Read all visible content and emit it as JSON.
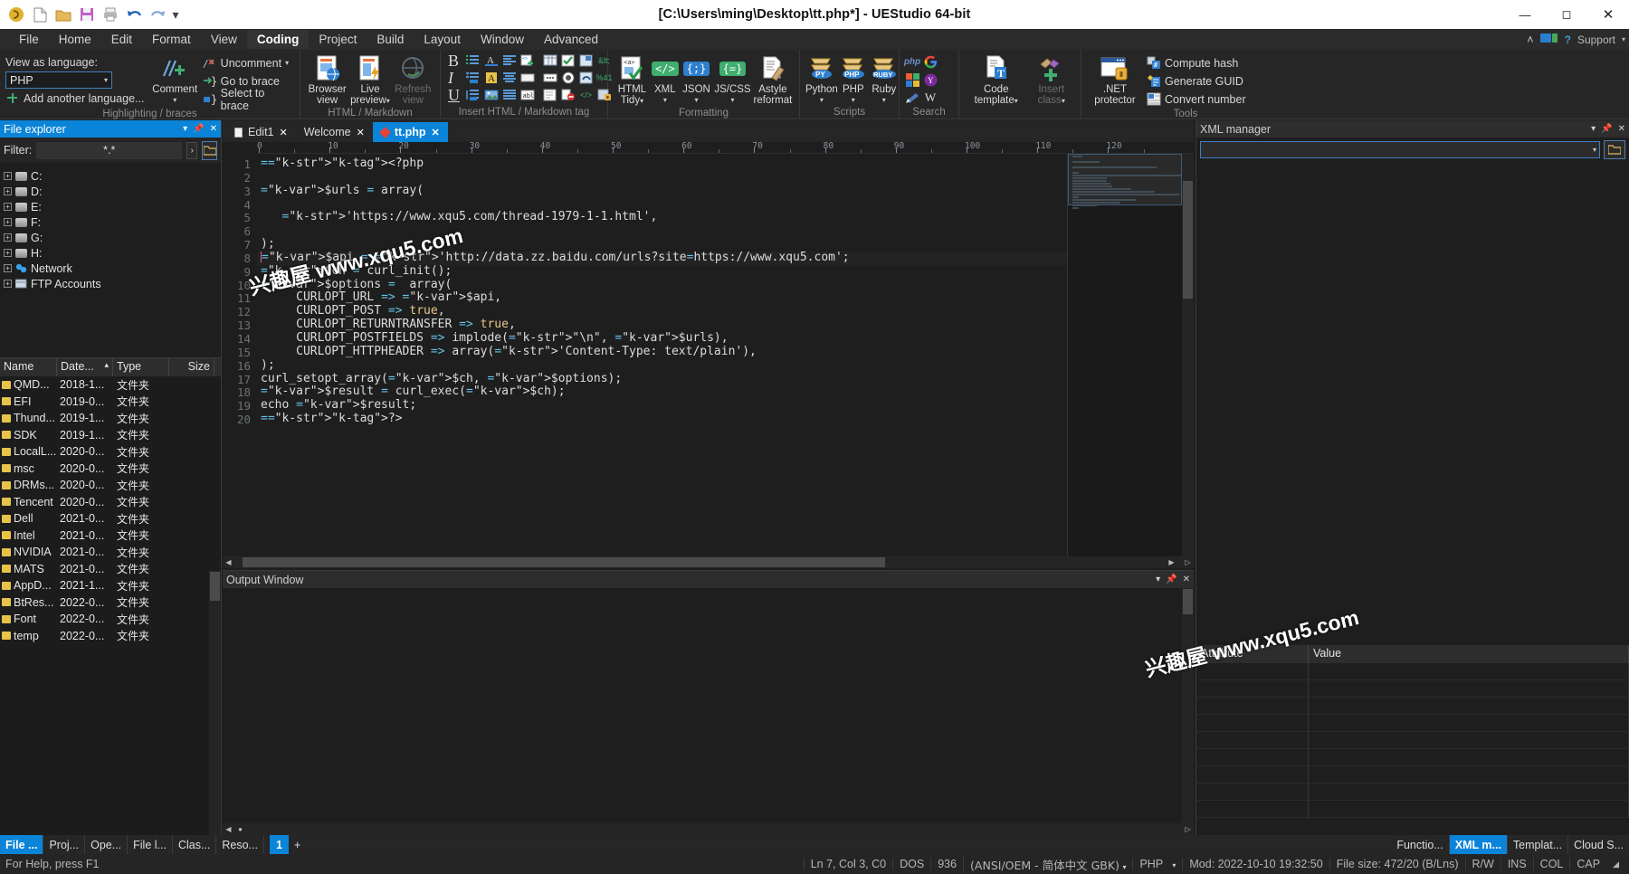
{
  "window": {
    "title": "[C:\\Users\\ming\\Desktop\\tt.php*] - UEStudio 64-bit",
    "minimize": "–",
    "maximize": "☐",
    "close": "✕"
  },
  "quick_access": [
    {
      "name": "app-logo-icon",
      "glyph": "ⓢ"
    },
    {
      "name": "new-file-icon",
      "glyph": "὜B"
    },
    {
      "name": "open-folder-icon",
      "glyph": "Ὄ1"
    },
    {
      "name": "save-icon",
      "glyph": "ὋE"
    },
    {
      "name": "print-icon",
      "glyph": "὚8"
    },
    {
      "name": "undo-icon",
      "glyph": "↶"
    },
    {
      "name": "redo-icon",
      "glyph": "↷"
    },
    {
      "name": "customize-qat-icon",
      "glyph": "▾"
    }
  ],
  "menu": {
    "items": [
      "File",
      "Home",
      "Edit",
      "Format",
      "View",
      "Coding",
      "Project",
      "Build",
      "Layout",
      "Window",
      "Advanced"
    ],
    "active": "Coding",
    "right": {
      "collapse": "˄",
      "account": "▤",
      "help": "?",
      "support": "Support",
      "support_caret": "▾"
    }
  },
  "ribbon": {
    "groups": [
      {
        "label": "Highlighting / braces",
        "view_as_language_label": "View as language:",
        "language_value": "PHP",
        "add_another_language": "Add another language...",
        "comment_label": "Comment",
        "uncomment_label": "Uncomment",
        "go_to_brace": "Go to brace",
        "select_to_brace": "Select to brace"
      },
      {
        "label": "HTML / Markdown",
        "buttons": [
          {
            "name": "browser-view-button",
            "line1": "Browser",
            "line2": "view",
            "disabled": false
          },
          {
            "name": "live-preview-button",
            "line1": "Live",
            "line2": "preview",
            "disabled": false,
            "caret": true
          },
          {
            "name": "refresh-view-button",
            "line1": "Refresh",
            "line2": "view",
            "disabled": true
          }
        ]
      },
      {
        "label": "Insert HTML / Markdown tag",
        "bold": "B",
        "italic": "I",
        "underline": "U"
      },
      {
        "label": "Formatting",
        "buttons": [
          {
            "name": "html-tidy-button",
            "line1": "HTML",
            "line2": "Tidy",
            "caret": true
          },
          {
            "name": "xml-format-button",
            "line1": "XML",
            "line2": "",
            "caret": true,
            "badge": "</>",
            "badgecolor": "#3fae6e"
          },
          {
            "name": "json-format-button",
            "line1": "JSON",
            "line2": "",
            "caret": true,
            "badge": "{;}",
            "badgecolor": "#2f7fd0"
          },
          {
            "name": "jscss-format-button",
            "line1": "JS/CSS",
            "line2": "",
            "caret": true,
            "badge": "{=}",
            "badgecolor": "#3fae6e"
          },
          {
            "name": "astyle-reformat-button",
            "line1": "Astyle",
            "line2": "reformat"
          }
        ]
      },
      {
        "label": "Scripts",
        "buttons": [
          {
            "name": "python-script-button",
            "line1": "Python",
            "badge": "PY",
            "caret": true
          },
          {
            "name": "php-script-button",
            "line1": "PHP",
            "badge": "PHP",
            "caret": true
          },
          {
            "name": "ruby-script-button",
            "line1": "Ruby",
            "badge": "RUBY",
            "caret": true
          }
        ]
      },
      {
        "label": "Search",
        "icons": [
          "php-search-icon",
          "google-search-icon",
          "microsoft-search-icon",
          "yahoo-search-icon",
          "stackoverflow-search-icon",
          "wikipedia-search-icon"
        ]
      },
      {
        "label": "",
        "code_template": {
          "line1": "Code",
          "line2": "template",
          "caret": true
        },
        "insert_class": {
          "line1": "Insert",
          "line2": "class",
          "caret": true,
          "disabled": true
        }
      },
      {
        "label": "Tools",
        "net_protector": {
          "line1": ".NET",
          "line2": "protector"
        },
        "tools": [
          "Compute hash",
          "Generate GUID",
          "Convert number"
        ]
      }
    ]
  },
  "file_explorer": {
    "title": "File explorer",
    "header_icons": [
      "chevron-down-icon",
      "pin-icon",
      "close-icon"
    ],
    "filter_label": "Filter:",
    "filter_value": "*.*",
    "filter_go": "›",
    "browse_icon": "folder-icon",
    "tree": [
      {
        "label": "C:",
        "icon": "drive-icon"
      },
      {
        "label": "D:",
        "icon": "drive-icon"
      },
      {
        "label": "E:",
        "icon": "drive-icon"
      },
      {
        "label": "F:",
        "icon": "drive-icon"
      },
      {
        "label": "G:",
        "icon": "drive-icon"
      },
      {
        "label": "H:",
        "icon": "drive-icon"
      },
      {
        "label": "Network",
        "icon": "network-icon"
      },
      {
        "label": "FTP Accounts",
        "icon": "ftp-icon"
      }
    ],
    "grid": {
      "columns": [
        "Name",
        "Date...",
        "Type",
        "Size"
      ],
      "sort_indicator": "▴",
      "rows": [
        {
          "name": "QMD...",
          "date": "2018-1...",
          "type": "文件夹",
          "size": ""
        },
        {
          "name": "EFI",
          "date": "2019-0...",
          "type": "文件夹",
          "size": ""
        },
        {
          "name": "Thund...",
          "date": "2019-1...",
          "type": "文件夹",
          "size": ""
        },
        {
          "name": "SDK",
          "date": "2019-1...",
          "type": "文件夹",
          "size": ""
        },
        {
          "name": "LocalL...",
          "date": "2020-0...",
          "type": "文件夹",
          "size": ""
        },
        {
          "name": "msc",
          "date": "2020-0...",
          "type": "文件夹",
          "size": ""
        },
        {
          "name": "DRMs...",
          "date": "2020-0...",
          "type": "文件夹",
          "size": ""
        },
        {
          "name": "Tencent",
          "date": "2020-0...",
          "type": "文件夹",
          "size": ""
        },
        {
          "name": "Dell",
          "date": "2021-0...",
          "type": "文件夹",
          "size": ""
        },
        {
          "name": "Intel",
          "date": "2021-0...",
          "type": "文件夹",
          "size": ""
        },
        {
          "name": "NVIDIA",
          "date": "2021-0...",
          "type": "文件夹",
          "size": ""
        },
        {
          "name": "MATS",
          "date": "2021-0...",
          "type": "文件夹",
          "size": ""
        },
        {
          "name": "AppD...",
          "date": "2021-1...",
          "type": "文件夹",
          "size": ""
        },
        {
          "name": "BtRes...",
          "date": "2022-0...",
          "type": "文件夹",
          "size": ""
        },
        {
          "name": "Font",
          "date": "2022-0...",
          "type": "文件夹",
          "size": ""
        },
        {
          "name": "temp",
          "date": "2022-0...",
          "type": "文件夹",
          "size": ""
        }
      ]
    }
  },
  "editor": {
    "tabs": [
      {
        "label": "Edit1",
        "active": false,
        "icon": "page-icon"
      },
      {
        "label": "Welcome",
        "active": false,
        "icon": "none"
      },
      {
        "label": "tt.php",
        "active": true,
        "icon": "modified-diamond-icon"
      }
    ],
    "ruler_labels": [
      "0",
      "10",
      "20",
      "30",
      "40",
      "50",
      "60",
      "70",
      "80",
      "90",
      "100",
      "110",
      "120"
    ],
    "cursor_line": 8,
    "lines": [
      {
        "n": 1,
        "text": "<?php"
      },
      {
        "n": 2,
        "text": ""
      },
      {
        "n": 3,
        "text": "$urls = array("
      },
      {
        "n": 4,
        "text": ""
      },
      {
        "n": 5,
        "text": "   'https://www.xqu5.com/thread-1979-1-1.html',"
      },
      {
        "n": 6,
        "text": ""
      },
      {
        "n": 7,
        "text": ");"
      },
      {
        "n": 8,
        "text": "$api = 'http://data.zz.baidu.com/urls?site=https://www.xqu5.com';"
      },
      {
        "n": 9,
        "text": "$ch = curl_init();"
      },
      {
        "n": 10,
        "text": "$options =  array("
      },
      {
        "n": 11,
        "text": "     CURLOPT_URL => $api,"
      },
      {
        "n": 12,
        "text": "     CURLOPT_POST => true,"
      },
      {
        "n": 13,
        "text": "     CURLOPT_RETURNTRANSFER => true,"
      },
      {
        "n": 14,
        "text": "     CURLOPT_POSTFIELDS => implode(\"\\n\", $urls),"
      },
      {
        "n": 15,
        "text": "     CURLOPT_HTTPHEADER => array('Content-Type: text/plain'),"
      },
      {
        "n": 16,
        "text": ");"
      },
      {
        "n": 17,
        "text": "curl_setopt_array($ch, $options);"
      },
      {
        "n": 18,
        "text": "$result = curl_exec($ch);"
      },
      {
        "n": 19,
        "text": "echo $result;"
      },
      {
        "n": 20,
        "text": "?>"
      }
    ]
  },
  "output_window": {
    "title": "Output Window",
    "header_icons": [
      "chevron-down-icon",
      "pin-icon",
      "close-icon"
    ],
    "content": ""
  },
  "xml_manager": {
    "title": "XML manager",
    "header_icons": [
      "chevron-down-icon",
      "pin-icon",
      "close-icon"
    ],
    "combo_value": "",
    "combo_caret": "▾",
    "open_icon": "folder-icon",
    "attr_table": {
      "columns": [
        "Attribute",
        "Value"
      ],
      "rows": [
        {
          "attribute": "",
          "value": ""
        },
        {
          "attribute": "",
          "value": ""
        },
        {
          "attribute": "",
          "value": ""
        },
        {
          "attribute": "",
          "value": ""
        },
        {
          "attribute": "",
          "value": ""
        },
        {
          "attribute": "",
          "value": ""
        },
        {
          "attribute": "",
          "value": ""
        },
        {
          "attribute": "",
          "value": ""
        },
        {
          "attribute": "",
          "value": ""
        }
      ]
    }
  },
  "bottom_tabs": {
    "left": [
      {
        "label": "File ...",
        "active": true
      },
      {
        "label": "Proj...",
        "active": false
      },
      {
        "label": "Ope...",
        "active": false
      },
      {
        "label": "File l...",
        "active": false
      },
      {
        "label": "Clas...",
        "active": false
      },
      {
        "label": "Reso...",
        "active": false
      }
    ],
    "group_tab": "1",
    "add_tab": "+",
    "right": [
      {
        "label": "Functio...",
        "active": false
      },
      {
        "label": "XML m...",
        "active": true
      },
      {
        "label": "Templat...",
        "active": false
      },
      {
        "label": "Cloud S...",
        "active": false
      }
    ]
  },
  "statusbar": {
    "help": "For Help, press F1",
    "position": "Ln 7, Col 3, C0",
    "line_ending": "DOS",
    "codepage": "936",
    "encoding": "(ANSI/OEM - 简体中文 GBK)",
    "encoding_caret": "▾",
    "language": "PHP",
    "language_caret": "▾",
    "modified": "Mod: 2022-10-10 19:32:50",
    "filesize": "File size: 472/20 (B/Lns)",
    "rw": "R/W",
    "ins": "INS",
    "col": "COL",
    "cap": "CAP"
  },
  "watermarks": [
    {
      "cn": "兴趣屋",
      "url": "www.xqu5.com"
    },
    {
      "cn": "兴趣屋",
      "url": "www.xqu5.com"
    }
  ],
  "colors": {
    "accent": "#0a84d8",
    "ribbon_bg": "#262626",
    "editor_bg": "#1e1e1e",
    "titlebar_bg": "#ffffff",
    "string": "#e8c98a",
    "variable": "#e06c85",
    "tag": "#e07a4a",
    "operator": "#65c3e8",
    "folder": "#e8c34a"
  }
}
